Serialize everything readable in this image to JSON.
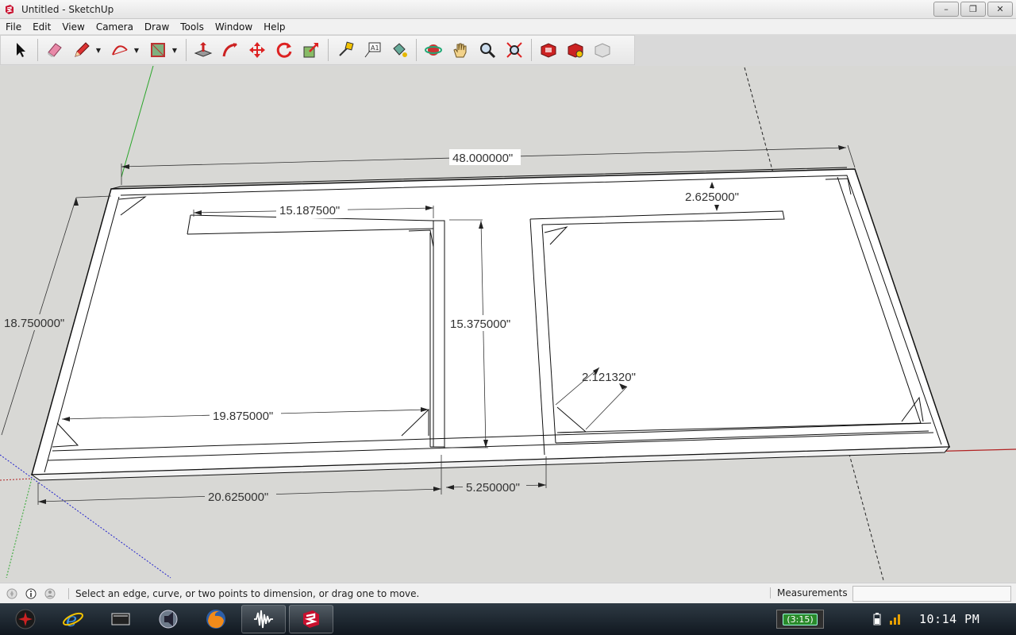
{
  "window": {
    "title": "Untitled - SketchUp",
    "minimize_symbol": "–",
    "restore_symbol": "❐",
    "close_symbol": "✕"
  },
  "menu": [
    "File",
    "Edit",
    "View",
    "Camera",
    "Draw",
    "Tools",
    "Window",
    "Help"
  ],
  "toolbar": {
    "tools": [
      "select-tool-icon",
      "eraser-tool-icon",
      "pencil-line-tool-icon",
      "arc-tool-icon",
      "rectangle-tool-icon",
      "push-pull-tool-icon",
      "follow-me-tool-icon",
      "move-tool-icon",
      "rotate-tool-icon",
      "scale-tool-icon",
      "tape-measure-tool-icon",
      "text-tool-icon",
      "paint-bucket-tool-icon",
      "orbit-tool-icon",
      "pan-tool-icon",
      "zoom-tool-icon",
      "zoom-extents-tool-icon",
      "3d-warehouse-icon",
      "share-model-icon",
      "extension-warehouse-icon"
    ]
  },
  "dimensions": {
    "overall_length": "48.000000\"",
    "depth": "18.750000\"",
    "top_rail": "15.187500\"",
    "right_inset": "2.625000\"",
    "divider_height": "15.375000\"",
    "diagonal_brace": "2.121320\"",
    "inner_span": "19.875000\"",
    "left_bay": "20.625000\"",
    "center_gap": "5.250000\""
  },
  "colors": {
    "axis_red": "#b22222",
    "axis_green": "#2aa52a",
    "axis_blue": "#2222cc",
    "sky": "#d8d8d5",
    "model_face": "#ffffff",
    "model_edge": "#111111"
  },
  "status": {
    "hint": "Select an edge, curve, or two points to dimension, or drag one to move.",
    "measurements_label": "Measurements",
    "measurements_value": ""
  },
  "taskbar": {
    "apps": [
      "start-orb-icon",
      "internet-explorer-icon",
      "window-switcher-icon",
      "media-player-icon",
      "firefox-icon",
      "audio-editor-icon",
      "sketchup-icon"
    ],
    "battery_time": "(3:15)",
    "clock": "10:14 PM"
  }
}
